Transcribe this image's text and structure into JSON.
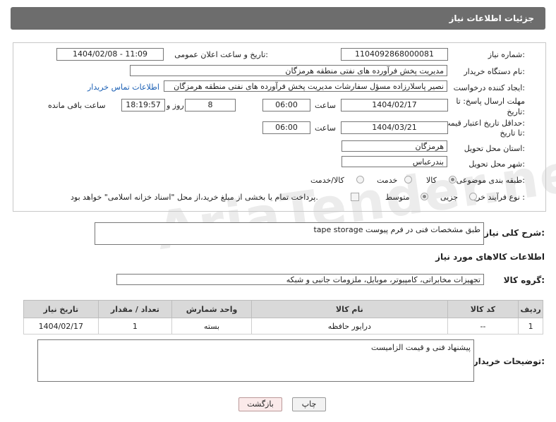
{
  "header": {
    "title": "جزئیات اطلاعات نیاز"
  },
  "form": {
    "need_number_label": "شماره نیاز:",
    "need_number": "1104092868000081",
    "announce_label": "تاریخ و ساعت اعلان عمومی:",
    "announce_value": "1404/02/08 - 11:09",
    "buyer_org_label": "نام دستگاه خریدار:",
    "buyer_org": "مدیریت پخش فرآورده های نفتی منطقه هرمزگان",
    "requester_label": "ایجاد کننده درخواست:",
    "requester": "نصیر پاسلارزاده مسؤل سفارشات مدیریت پخش فرآورده های نفتی منطقه هرمزگان",
    "contact_link": "اطلاعات تماس خریدار",
    "deadline_label_1": "مهلت ارسال پاسخ: تا",
    "deadline_label_2": "تاریخ:",
    "deadline_date": "1404/02/17",
    "time_label": "ساعت",
    "deadline_time": "06:00",
    "days_value": "8",
    "days_label": "روز و",
    "remaining_time": "18:19:57",
    "remaining_label": "ساعت باقی مانده",
    "validity_label_1": "حداقل تاریخ اعتبار قیمت:",
    "validity_label_2": "تا تاریخ:",
    "validity_date": "1404/03/21",
    "validity_time": "06:00",
    "province_label": "استان محل تحویل:",
    "province": "هرمزگان",
    "city_label": "شهر محل تحویل:",
    "city": "بندرعباس",
    "category_label": "طبقه بندی موضوعی:",
    "category_options": [
      "کالا",
      "خدمت",
      "کالا/خدمت"
    ],
    "process_label": "نوع فرآیند خرید :",
    "process_options": [
      "جزیی",
      "متوسط"
    ],
    "payment_note": "پرداخت تمام یا بخشی از مبلغ خرید،از محل \"اسناد خزانه اسلامی\" خواهد بود."
  },
  "summary": {
    "label": "شرح کلی نیاز:",
    "value": "tape storage  طبق مشخصات فنی در فرم پیوست"
  },
  "goods_info": {
    "title": "اطلاعات کالاهای مورد نیاز",
    "group_label": "گروه کالا:",
    "group_value": "تجهیزات مخابراتی، کامپیوتر، موبایل، ملزومات جانبی و شبکه"
  },
  "table": {
    "headers": [
      "ردیف",
      "کد کالا",
      "نام کالا",
      "واحد شمارش",
      "تعداد / مقدار",
      "تاریخ نیاز"
    ],
    "rows": [
      [
        "1",
        "--",
        "درایور حافظه",
        "بسته",
        "1",
        "1404/02/17"
      ]
    ]
  },
  "buyer_notes": {
    "label": "توضیحات خریدار:",
    "value": "پیشنهاد فنی و قیمت الزامیست"
  },
  "buttons": {
    "print": "چاپ",
    "back": "بازگشت"
  },
  "watermark": "AriaTender.neT"
}
